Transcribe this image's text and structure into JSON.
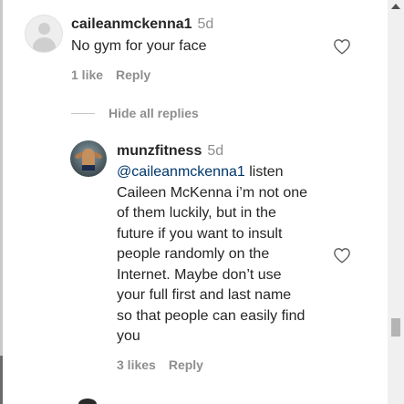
{
  "comments": [
    {
      "username": "caileanmckenna1",
      "time": "5d",
      "text": "No gym for your face",
      "likes": "1 like",
      "reply_label": "Reply"
    }
  ],
  "replies_toggle": "Hide all replies",
  "reply": {
    "username": "munzfitness",
    "time": "5d",
    "mention": "@caileanmckenna1",
    "lines": [
      " listen",
      "Caileen McKenna i’m not one",
      "of them luckily, but in the",
      "future if you want to insult",
      "people randomly on the",
      "Internet. Maybe don’t use",
      "your full first and last name",
      "so that people can easily find",
      "you"
    ],
    "likes": "3 likes",
    "reply_label": "Reply"
  },
  "icons": {
    "like": "heart-outline-icon",
    "scroll_up": "scroll-up-arrow-icon"
  }
}
